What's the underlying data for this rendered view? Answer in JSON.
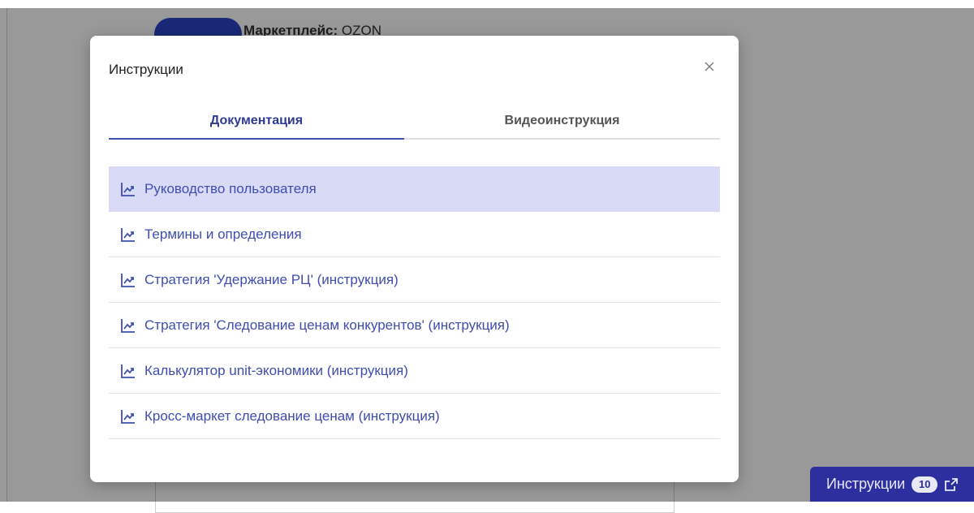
{
  "background": {
    "marketplace_label": "Маркетплейс:",
    "marketplace_value": "OZON"
  },
  "modal": {
    "title": "Инструкции",
    "close_icon": "close-icon",
    "tabs": [
      {
        "label": "Документация",
        "active": true
      },
      {
        "label": "Видеоинструкция",
        "active": false
      }
    ],
    "items": [
      {
        "label": "Руководство пользователя",
        "icon": "chart-line-icon",
        "selected": true
      },
      {
        "label": "Термины и определения",
        "icon": "chart-line-icon",
        "selected": false
      },
      {
        "label": "Стратегия 'Удержание РЦ' (инструкция)",
        "icon": "chart-line-icon",
        "selected": false
      },
      {
        "label": "Стратегия 'Следование ценам конкурентов' (инструкция)",
        "icon": "chart-line-icon",
        "selected": false
      },
      {
        "label": "Калькулятор unit-экономики (инструкция)",
        "icon": "chart-line-icon",
        "selected": false
      },
      {
        "label": "Кросс-маркет следование ценам (инструкция)",
        "icon": "chart-line-icon",
        "selected": false
      }
    ]
  },
  "floating_button": {
    "label": "Инструкции",
    "badge": "10",
    "icon": "external-link-icon"
  },
  "colors": {
    "accent": "#3f51b5",
    "selected_bg": "#d8daf6",
    "floating_button_bg": "#2d2f9e"
  }
}
